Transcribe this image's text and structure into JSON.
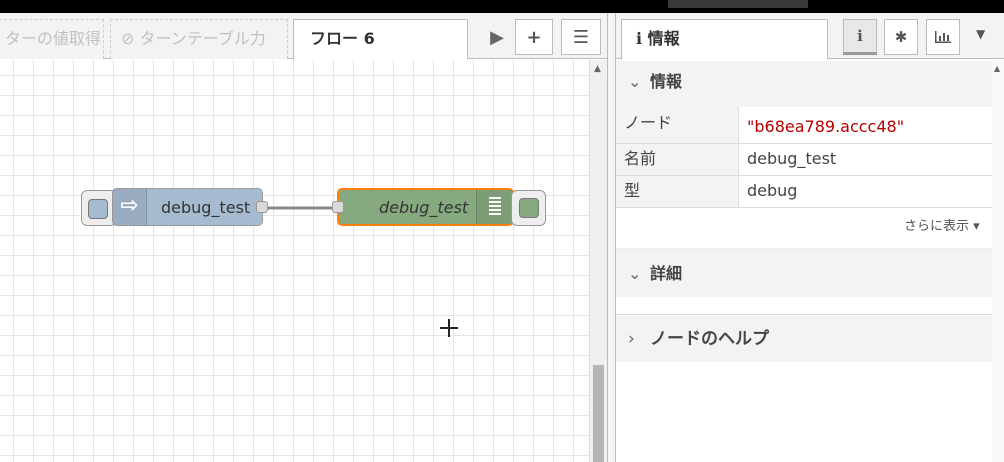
{
  "workspace": {
    "tabs": [
      {
        "label": "ターの値取得",
        "disabled": true
      },
      {
        "label": "⊘ ターンテーブル力",
        "disabled": true
      },
      {
        "label": "フロー 6",
        "active": true
      }
    ],
    "buttons": {
      "scroll_right": "▶",
      "add_flow": "+",
      "list_flows": "☰"
    },
    "nodes": [
      {
        "id": "inject-node",
        "label": "debug_test",
        "color": "#a6bbcf",
        "icon": "arrow-right-icon"
      },
      {
        "id": "debug-node",
        "label": "debug_test",
        "color": "#87a980",
        "selected_color": "#ff7f0e",
        "italic": true,
        "icon": "list-icon"
      }
    ],
    "cursor": "+"
  },
  "sidebar": {
    "tab_label": "ℹ 情報",
    "tab_buttons": [
      "info-icon",
      "bug-icon",
      "chart-icon",
      "chevron-down-icon"
    ],
    "info_section": "情報",
    "properties": [
      {
        "key": "ノード",
        "value": "\"b68ea789.accc48\"",
        "value_color": "#b50000"
      },
      {
        "key": "名前",
        "value": "debug_test"
      },
      {
        "key": "型",
        "value": "debug"
      }
    ],
    "show_more": "さらに表示 ▾",
    "detail_section": "詳細",
    "help_section": "ノードのヘルプ"
  }
}
